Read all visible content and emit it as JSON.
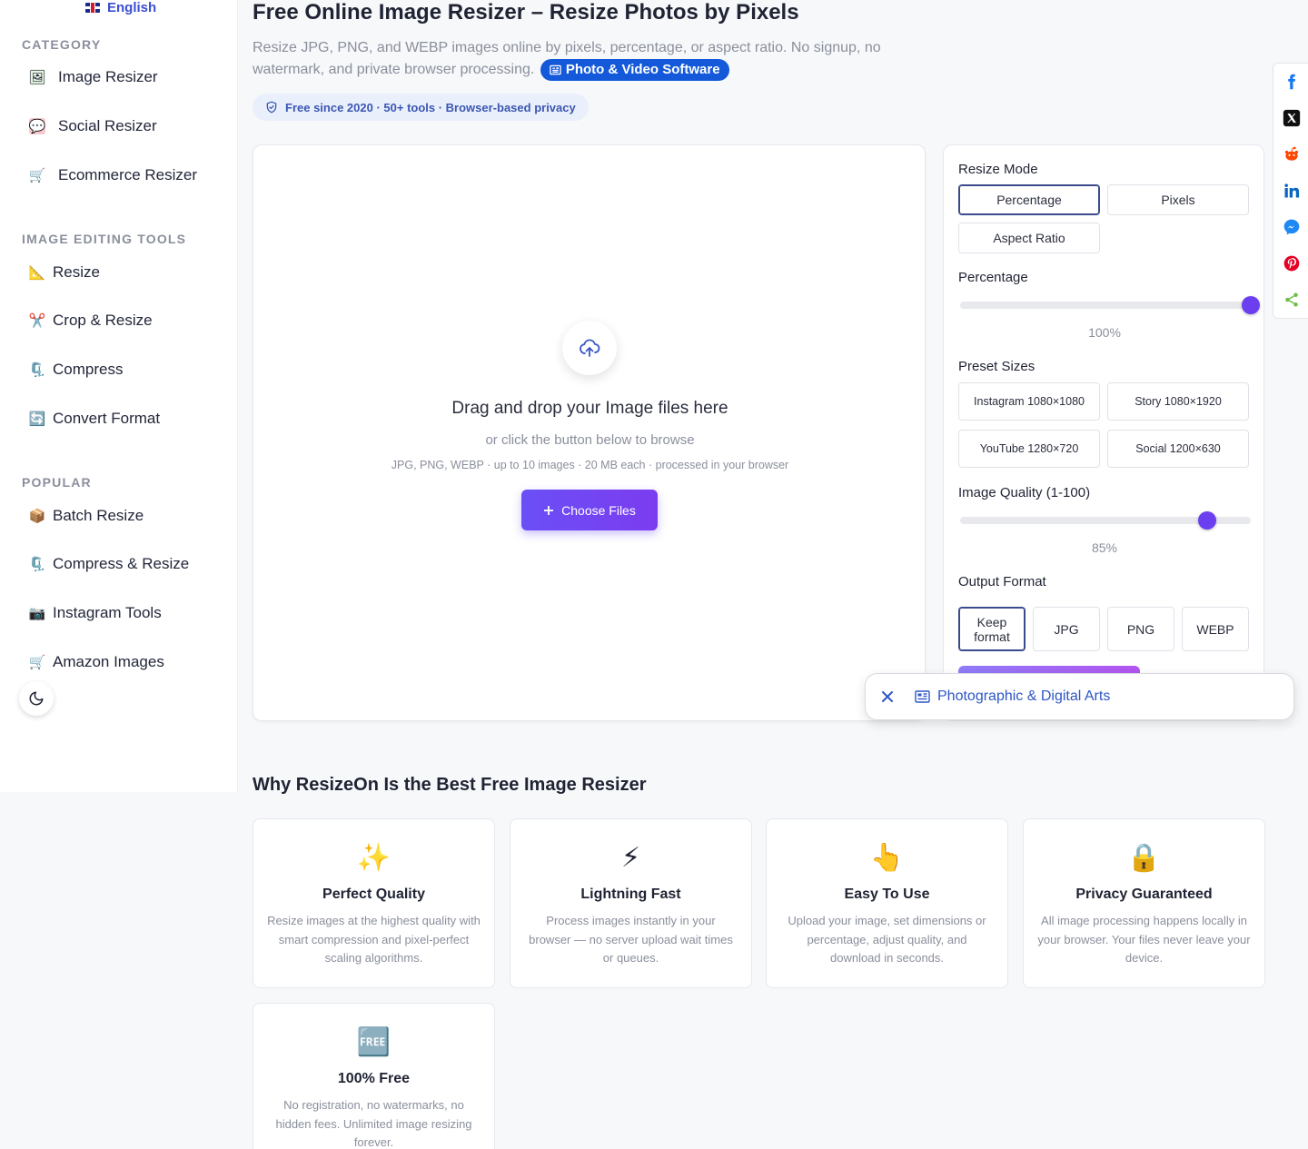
{
  "sidebar": {
    "language": "English",
    "sections": [
      {
        "title": "CATEGORY"
      },
      {
        "title": "IMAGE EDITING TOOLS"
      },
      {
        "title": "POPULAR"
      }
    ],
    "category_items": [
      {
        "label": "Image Resizer",
        "icon": "🖼"
      },
      {
        "label": "Social Resizer",
        "icon": "💬"
      },
      {
        "label": "Ecommerce Resizer",
        "icon": "🛒"
      }
    ],
    "editing_items": [
      {
        "label": "Resize",
        "icon": "📐"
      },
      {
        "label": "Crop & Resize",
        "icon": "✂️"
      },
      {
        "label": "Compress",
        "icon": "🗜️"
      },
      {
        "label": "Convert Format",
        "icon": "🔄"
      }
    ],
    "popular_items": [
      {
        "label": "Batch Resize",
        "icon": "📦"
      },
      {
        "label": "Compress & Resize",
        "icon": "🗜️"
      },
      {
        "label": "Instagram Tools",
        "icon": "📷"
      },
      {
        "label": "Amazon Images",
        "icon": "🛒"
      }
    ]
  },
  "header": {
    "title": "Free Online Image Resizer – Resize Photos by Pixels",
    "description": "Resize JPG, PNG, and WEBP images online by pixels, percentage, or aspect ratio. No signup, no watermark, and private browser processing.",
    "category_pill": "Photo & Video Software",
    "trust_badge": "Free since 2020 · 50+ tools · Browser-based privacy"
  },
  "upload": {
    "title": "Drag and drop your Image files here",
    "subtitle": "or click the button below to browse",
    "note": "JPG, PNG, WEBP · up to 10 images · 20 MB each · processed in your browser",
    "button": "Choose Files"
  },
  "settings": {
    "resize_mode_label": "Resize Mode",
    "modes": [
      "Percentage",
      "Pixels",
      "Aspect Ratio"
    ],
    "selected_mode": "Percentage",
    "percentage_label": "Percentage",
    "percentage_value": 100,
    "percentage_text": "100%",
    "presets_label": "Preset Sizes",
    "presets": [
      "Instagram 1080×1080",
      "Story 1080×1920",
      "YouTube 1280×720",
      "Social 1200×630"
    ],
    "quality_label": "Image Quality (1-100)",
    "quality_value": 85,
    "quality_text": "85%",
    "format_label": "Output Format",
    "formats": [
      "Keep format",
      "JPG",
      "PNG",
      "WEBP"
    ],
    "selected_format": "Keep format"
  },
  "share": [
    "facebook-icon",
    "x-icon",
    "reddit-icon",
    "linkedin-icon",
    "messenger-icon",
    "pinterest-icon",
    "share-icon"
  ],
  "toast": {
    "text": "Photographic & Digital Arts"
  },
  "features": {
    "heading": "Why ResizeOn Is the Best Free Image Resizer",
    "cards": [
      {
        "icon": "✨",
        "title": "Perfect Quality",
        "desc": "Resize images at the highest quality with smart compression and pixel-perfect scaling algorithms."
      },
      {
        "icon": "⚡",
        "title": "Lightning Fast",
        "desc": "Process images instantly in your browser — no server upload wait times or queues."
      },
      {
        "icon": "👆",
        "title": "Easy To Use",
        "desc": "Upload your image, set dimensions or percentage, adjust quality, and download in seconds."
      },
      {
        "icon": "🔒",
        "title": "Privacy Guaranteed",
        "desc": "All image processing happens locally in your browser. Your files never leave your device."
      },
      {
        "icon": "🆓",
        "title": "100% Free",
        "desc": "No registration, no watermarks, no hidden fees. Unlimited image resizing forever."
      }
    ]
  },
  "colors": {
    "accent": "#6b3ff0",
    "pill": "#1459d9",
    "link": "#2e57c6"
  }
}
